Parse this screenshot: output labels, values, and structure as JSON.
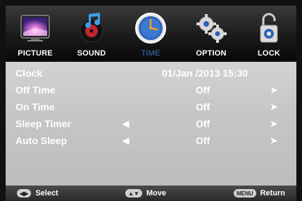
{
  "menu": {
    "items": [
      {
        "label": "PICTURE",
        "icon": "picture-icon"
      },
      {
        "label": "SOUND",
        "icon": "sound-icon"
      },
      {
        "label": "TIME",
        "icon": "clock-icon"
      },
      {
        "label": "OPTION",
        "icon": "gears-icon"
      },
      {
        "label": "LOCK",
        "icon": "lock-icon"
      }
    ],
    "active_index": 2,
    "active_color": "#3b6fc4"
  },
  "settings": [
    {
      "label": "Clock",
      "value": "01/Jan  /2013 15:30"
    },
    {
      "label": "Off Time",
      "value": "Off"
    },
    {
      "label": "On Time",
      "value": "Off"
    },
    {
      "label": "Sleep Timer",
      "value": "Off"
    },
    {
      "label": "Auto Sleep",
      "value": "Off"
    }
  ],
  "footer": {
    "select": {
      "label": "Select",
      "icon": "left-right-arrows-icon"
    },
    "move": {
      "label": "Move",
      "icon": "up-down-arrows-icon"
    },
    "return": {
      "key": "MENU",
      "label": "Return"
    }
  },
  "colors": {
    "panel": "#c6c6c6",
    "text": "#ffffff",
    "bar": "#1b1b1b"
  }
}
